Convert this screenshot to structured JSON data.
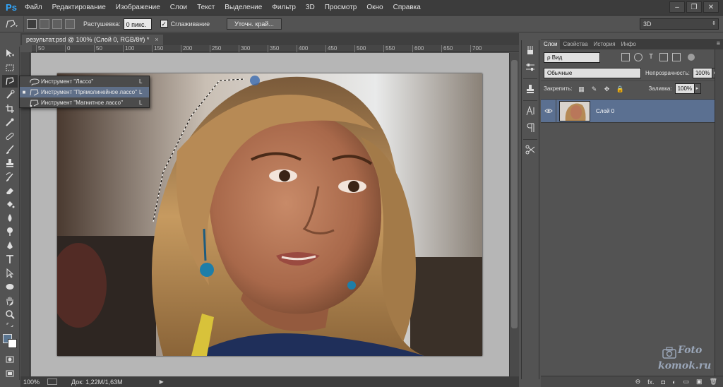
{
  "app": {
    "logo": "Ps"
  },
  "menu": [
    "Файл",
    "Редактирование",
    "Изображение",
    "Слои",
    "Текст",
    "Выделение",
    "Фильтр",
    "3D",
    "Просмотр",
    "Окно",
    "Справка"
  ],
  "window_controls": {
    "minimize": "–",
    "restore": "❐",
    "close": "✕"
  },
  "options_bar": {
    "feather_label": "Растушевка:",
    "feather_value": "0 пикс.",
    "antialias_label": "Сглаживание",
    "antialias_checked": true,
    "refine_button": "Уточн. край...",
    "workspace": "3D"
  },
  "document": {
    "tab_title": "результат.psd @ 100% (Слой 0, RGB/8#) *",
    "close": "×",
    "ruler_ticks": [
      "50",
      "0",
      "50",
      "100",
      "150",
      "200",
      "250",
      "300",
      "350",
      "400",
      "450",
      "500",
      "550",
      "600",
      "650",
      "700"
    ]
  },
  "status": {
    "zoom": "100%",
    "doc_size": "Док: 1,22M/1,63M",
    "arrow": "▶"
  },
  "flyout": {
    "items": [
      {
        "label": "Инструмент \"Лассо\"",
        "key": "L",
        "active": false,
        "bullet": ""
      },
      {
        "label": "Инструмент \"Прямолинейное лассо\"",
        "key": "L",
        "active": true,
        "bullet": "■"
      },
      {
        "label": "Инструмент \"Магнитное лассо\"",
        "key": "L",
        "active": false,
        "bullet": ""
      }
    ]
  },
  "layers_panel": {
    "tabs": [
      "Слои",
      "Свойства",
      "История",
      "Инфо"
    ],
    "menu_icon": "≡",
    "filter_value": "ρ Вид",
    "blend_mode": "Обычные",
    "opacity_label": "Непрозрачность:",
    "opacity_value": "100%",
    "lock_label": "Закрепить:",
    "fill_label": "Заливка:",
    "fill_value": "100%",
    "layer_name": "Слой 0",
    "bottom_icons": [
      "⊖",
      "fx.",
      "◘",
      "◐",
      "▭",
      "▣",
      "🗑"
    ]
  },
  "watermark": {
    "line1": "Foto",
    "line2": "komok.ru"
  },
  "colors": {
    "foreground": "#5a7590",
    "background": "#ffffff",
    "selection": "#5f6f88"
  }
}
